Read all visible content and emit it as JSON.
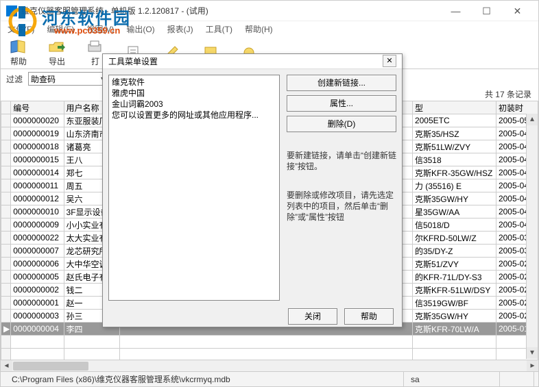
{
  "window": {
    "title": "维克仪器客服管理系统 - 单机版 1.2.120817 - (试用)",
    "min": "—",
    "max": "☐",
    "close": "✕"
  },
  "menubar": [
    "文件(F)",
    "编辑(E)",
    "视图(V)",
    "输出(O)",
    "报表(J)",
    "工具(T)",
    "帮助(H)"
  ],
  "toolbar": [
    {
      "label": "帮助"
    },
    {
      "label": "导出"
    },
    {
      "label": "打"
    }
  ],
  "watermark": {
    "big": "河东软件园",
    "url": "www.pc0359.cn"
  },
  "filter": {
    "label": "过滤",
    "col_label": "助查码"
  },
  "count_text": "共 17 条记录",
  "columns": [
    "",
    "编号",
    "用户名称",
    "型",
    "初装时"
  ],
  "rows": [
    {
      "id": "0000000020",
      "name": "东亚服装厂",
      "model": "2005ETC",
      "date": "2005-05"
    },
    {
      "id": "0000000019",
      "name": "山东济南市",
      "model": "克斯35/HSZ",
      "date": "2005-04"
    },
    {
      "id": "0000000018",
      "name": "诸葛亮",
      "model": "克斯51LW/ZVY",
      "date": "2005-04"
    },
    {
      "id": "0000000015",
      "name": "王八",
      "model": "信3518",
      "date": "2005-04"
    },
    {
      "id": "0000000014",
      "name": "郑七",
      "model": "克斯KFR-35GW/HSZ",
      "date": "2005-04"
    },
    {
      "id": "0000000011",
      "name": "周五",
      "model": "力 (35516) E",
      "date": "2005-04"
    },
    {
      "id": "0000000012",
      "name": "吴六",
      "model": "克斯35GW/HY",
      "date": "2005-04"
    },
    {
      "id": "0000000010",
      "name": "3F显示设备有",
      "model": "星35GW/AA",
      "date": "2005-04"
    },
    {
      "id": "0000000009",
      "name": "小小实业有限",
      "model": "信5018/D",
      "date": "2005-04"
    },
    {
      "id": "0000000022",
      "name": "太大实业有限",
      "model": "尔KFRD-50LW/Z",
      "date": "2005-03"
    },
    {
      "id": "0000000007",
      "name": "龙芯研究所",
      "model": "的35/DY-Z",
      "date": "2005-03"
    },
    {
      "id": "0000000006",
      "name": "大中华空调集",
      "model": "克斯51/ZVY",
      "date": "2005-02"
    },
    {
      "id": "0000000005",
      "name": "赵氏电子有限",
      "model": "的KFR-71L/DY-S3",
      "date": "2005-02"
    },
    {
      "id": "0000000002",
      "name": "钱二",
      "model": "克斯KFR-51LW/DSY",
      "date": "2005-02"
    },
    {
      "id": "0000000001",
      "name": "赵一",
      "model": "信3519GW/BF",
      "date": "2005-02"
    },
    {
      "id": "0000000003",
      "name": "孙三",
      "model": "克斯35GW/HY",
      "date": "2005-02"
    },
    {
      "id": "0000000004",
      "name": "李四",
      "model": "克斯KFR-70LW/A",
      "date": "2005-01",
      "selected": true
    }
  ],
  "dialog": {
    "title": "工具菜单设置",
    "list": [
      "维克软件",
      "雅虎中国",
      "金山词霸2003",
      "您可以设置更多的网址或其他应用程序..."
    ],
    "btn_new": "创建新链接...",
    "btn_prop": "属性...",
    "btn_del": "删除(D)",
    "hint1": "要新建链接，请单击“创建新链接”按钮。",
    "hint2": "要删除或修改项目，请先选定列表中的项目，然后单击“删除”或“属性”按钮",
    "btn_close": "关闭",
    "btn_help": "帮助"
  },
  "status": {
    "path": "C:\\Program Files (x86)\\维克仪器客服管理系统\\vkcrmyq.mdb",
    "user": "sa"
  }
}
